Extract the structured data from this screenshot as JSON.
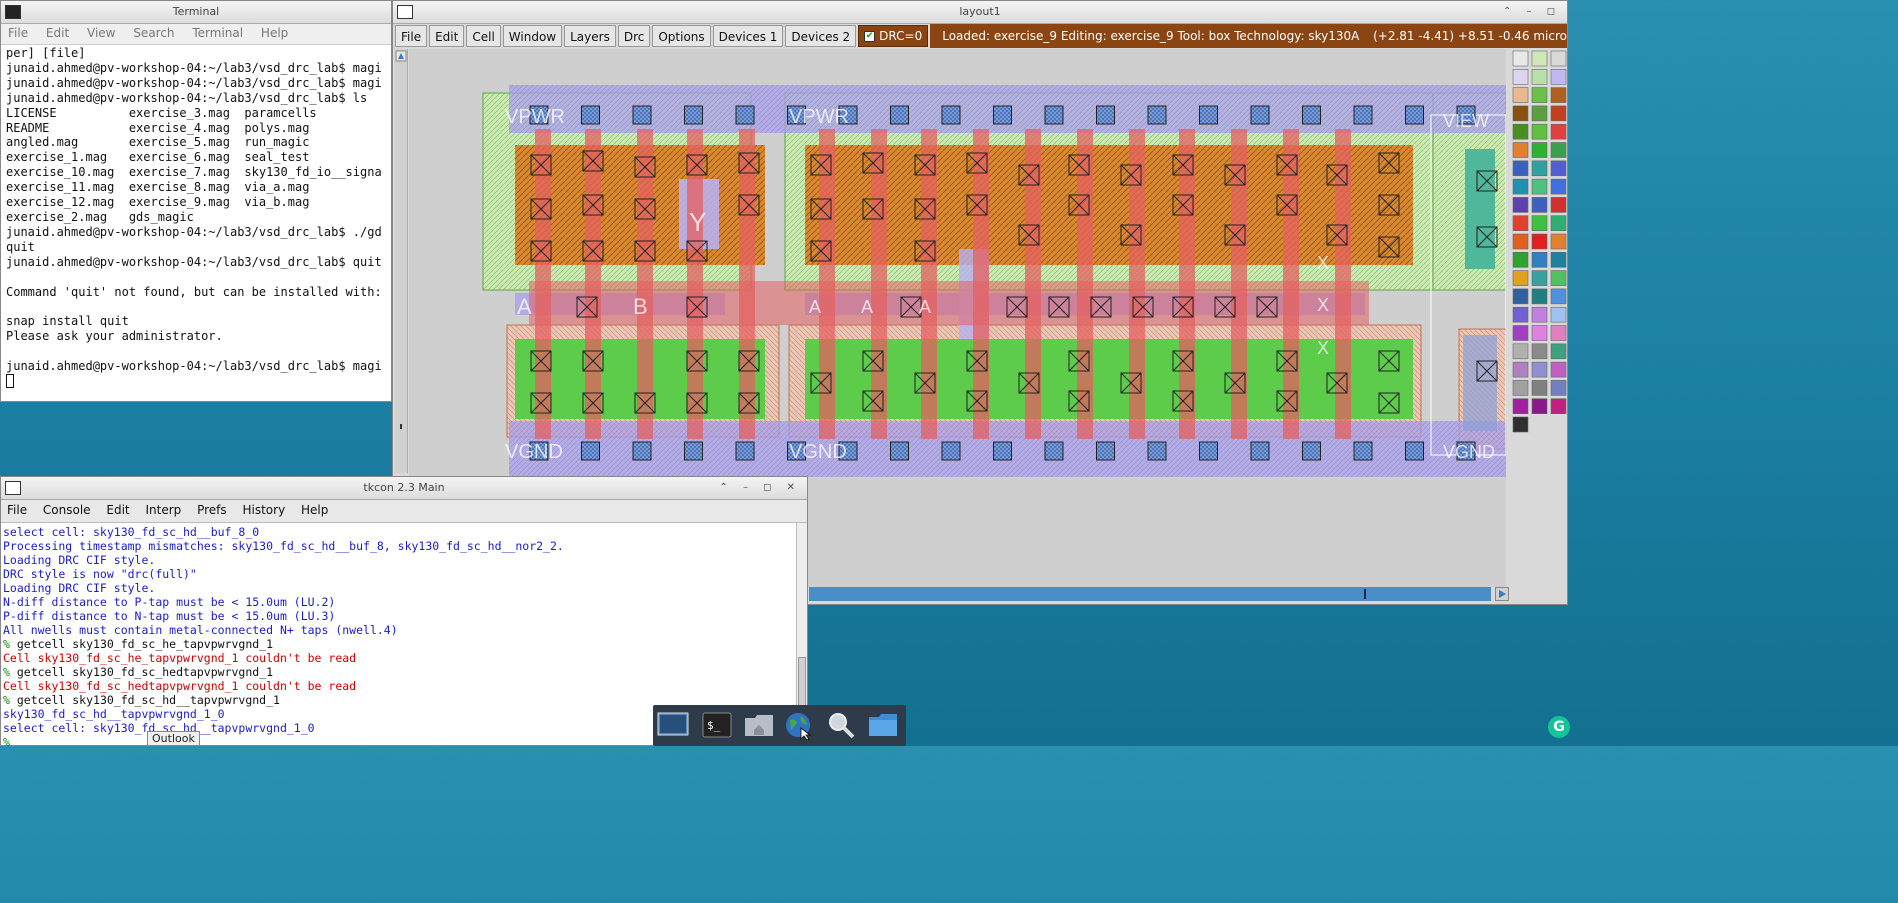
{
  "terminal": {
    "title": "Terminal",
    "menu": [
      "File",
      "Edit",
      "View",
      "Search",
      "Terminal",
      "Help"
    ],
    "lines": [
      "per] [file]",
      "junaid.ahmed@pv-workshop-04:~/lab3/vsd_drc_lab$ magi",
      "junaid.ahmed@pv-workshop-04:~/lab3/vsd_drc_lab$ magi",
      "junaid.ahmed@pv-workshop-04:~/lab3/vsd_drc_lab$ ls",
      "LICENSE          exercise_3.mag  paramcells",
      "README           exercise_4.mag  polys.mag",
      "angled.mag       exercise_5.mag  run_magic",
      "exercise_1.mag   exercise_6.mag  seal_test",
      "exercise_10.mag  exercise_7.mag  sky130_fd_io__signa",
      "exercise_11.mag  exercise_8.mag  via_a.mag",
      "exercise_12.mag  exercise_9.mag  via_b.mag",
      "exercise_2.mag   gds_magic",
      "junaid.ahmed@pv-workshop-04:~/lab3/vsd_drc_lab$ ./gd",
      "quit",
      "junaid.ahmed@pv-workshop-04:~/lab3/vsd_drc_lab$ quit",
      "",
      "Command 'quit' not found, but can be installed with:",
      "",
      "snap install quit",
      "Please ask your administrator.",
      "",
      "junaid.ahmed@pv-workshop-04:~/lab3/vsd_drc_lab$ magi"
    ]
  },
  "magic": {
    "title": "layout1",
    "menu": [
      "File",
      "Edit",
      "Cell",
      "Window",
      "Layers",
      "Drc",
      "Options",
      "Devices 1",
      "Devices 2"
    ],
    "drc_label": "DRC=0",
    "status": "Loaded: exercise_9 Editing: exercise_9 Tool: box  Technology: sky130A",
    "coords": "(+2.81 -4.41) +8.51 -0.46 micro",
    "labels": {
      "vpwr_left": "VPWR",
      "vpwr_mid": "VPWR",
      "vgnd_left": "VGND",
      "vgnd_mid": "VGND",
      "a_left": "A",
      "b_left": "B",
      "y_left": "Y",
      "a1": "A",
      "a2": "A",
      "a3": "A",
      "x1": "X",
      "x2": "X",
      "x3": "X",
      "view_right": "VIEW",
      "vgnd_right": "VGND"
    }
  },
  "tkcon": {
    "title": "tkcon 2.3 Main",
    "menu": [
      "File",
      "Console",
      "Edit",
      "Interp",
      "Prefs",
      "History",
      "Help"
    ],
    "lines": [
      {
        "t": "select cell: sky130_fd_sc_hd__buf_8_0",
        "c": "blue"
      },
      {
        "t": "Processing timestamp mismatches: sky130_fd_sc_hd__buf_8, sky130_fd_sc_hd__nor2_2.",
        "c": "blue"
      },
      {
        "t": "Loading DRC CIF style.",
        "c": "blue"
      },
      {
        "t": "DRC style is now \"drc(full)\"",
        "c": "blue"
      },
      {
        "t": "Loading DRC CIF style.",
        "c": "blue"
      },
      {
        "t": "N-diff distance to P-tap must be < 15.0um (LU.2)",
        "c": "blue"
      },
      {
        "t": "P-diff distance to N-tap must be < 15.0um (LU.3)",
        "c": "blue"
      },
      {
        "t": "All nwells must contain metal-connected N+ taps (nwell.4)",
        "c": "blue"
      },
      {
        "t": "% getcell sky130_fd_sc_he_tapvpwrvgnd_1",
        "c": "prompt"
      },
      {
        "t": "Cell sky130_fd_sc_he_tapvpwrvgnd_1 couldn't be read",
        "c": "red"
      },
      {
        "t": "% getcell sky130_fd_sc_hedtapvpwrvgnd_1",
        "c": "prompt"
      },
      {
        "t": "Cell sky130_fd_sc_hedtapvpwrvgnd_1 couldn't be read",
        "c": "red"
      },
      {
        "t": "% getcell sky130_fd_sc_hd__tapvpwrvgnd_1",
        "c": "prompt"
      },
      {
        "t": "sky130_fd_sc_hd__tapvpwrvgnd_1_0",
        "c": "blue"
      },
      {
        "t": "select cell: sky130_fd_sc_hd__tapvpwrvgnd_1_0",
        "c": "blue"
      },
      {
        "t": "% ",
        "c": "prompt"
      }
    ]
  },
  "tooltip": "Outlook",
  "taskbar": [
    "desktop-icon",
    "terminal-icon",
    "home-folder-icon",
    "web-browser-icon",
    "search-icon",
    "file-manager-icon"
  ],
  "grammarly_badge": "G"
}
